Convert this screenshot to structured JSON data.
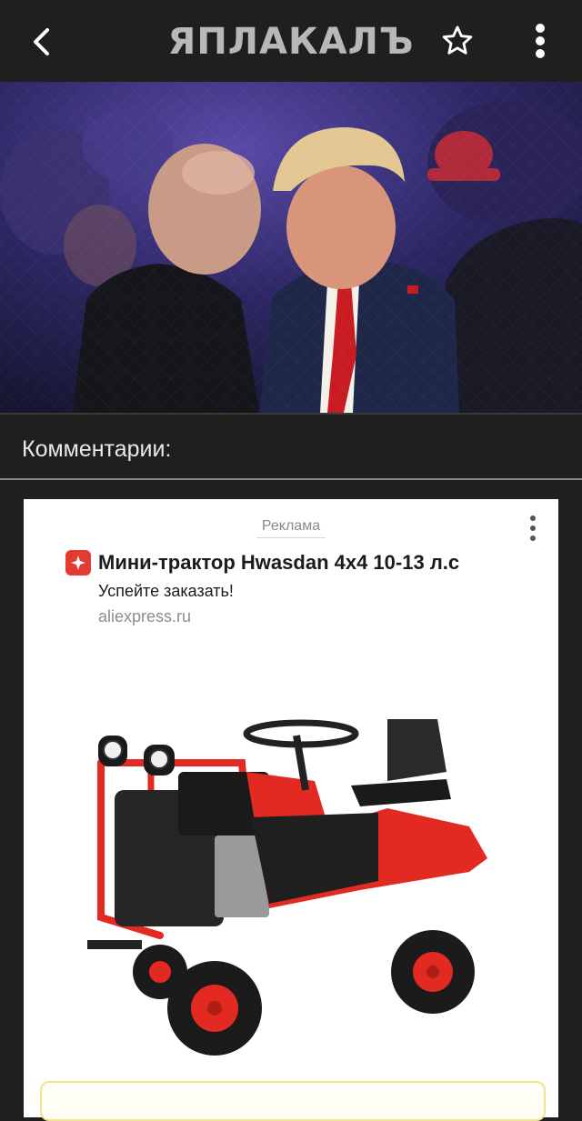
{
  "app": {
    "logo_text": "ЯПЛАКАЛЪ",
    "icons": {
      "back": "back-arrow-icon",
      "favorite": "star-icon",
      "menu": "more-vert-icon"
    }
  },
  "post": {
    "hero_image": "photo"
  },
  "comments": {
    "title": "Комментарии:"
  },
  "ad": {
    "label": "Реклама",
    "title": "Мини-трактор Hwasdan 4x4 10-13 л.с",
    "subtitle": "Успейте заказать!",
    "domain": "aliexpress.ru",
    "brand_color": "#e43b30"
  },
  "colors": {
    "background": "#1f1f1f",
    "logo": "#b8b8b8",
    "ad_background": "#ffffff",
    "tractor_red": "#e32a22"
  }
}
